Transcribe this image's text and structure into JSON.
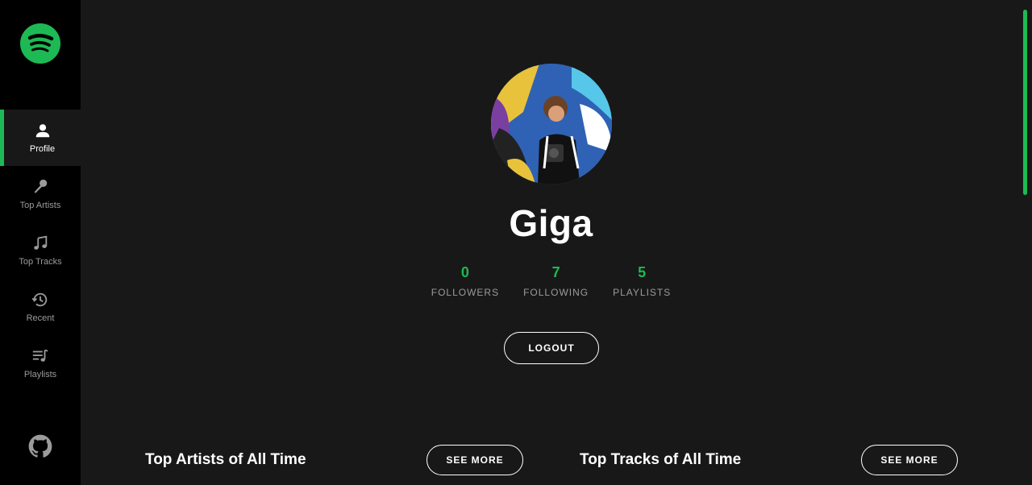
{
  "sidebar": {
    "logo_icon": "spotify-logo-icon",
    "items": [
      {
        "label": "Profile",
        "icon": "user-icon",
        "active": true
      },
      {
        "label": "Top Artists",
        "icon": "microphone-icon",
        "active": false
      },
      {
        "label": "Top Tracks",
        "icon": "music-note-icon",
        "active": false
      },
      {
        "label": "Recent",
        "icon": "history-icon",
        "active": false
      },
      {
        "label": "Playlists",
        "icon": "playlist-icon",
        "active": false
      }
    ],
    "github_icon": "github-icon"
  },
  "profile": {
    "name": "Giga",
    "stats": [
      {
        "value": "0",
        "label": "FOLLOWERS"
      },
      {
        "value": "7",
        "label": "FOLLOWING"
      },
      {
        "value": "5",
        "label": "PLAYLISTS"
      }
    ],
    "logout_label": "LOGOUT"
  },
  "sections": {
    "top_artists_title": "Top Artists of All Time",
    "top_tracks_title": "Top Tracks of All Time",
    "see_more_label": "SEE MORE"
  },
  "colors": {
    "accent": "#1db954",
    "background": "#181818",
    "sidebar": "#000000"
  }
}
